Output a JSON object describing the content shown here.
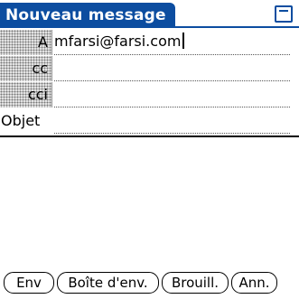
{
  "app": {
    "title": "Nouveau message"
  },
  "colors": {
    "accent": "#0c4da0",
    "background": "#ffffff",
    "text": "#000000"
  },
  "icons": {
    "menu": "menu-icon"
  },
  "fields": {
    "to": {
      "label": "A",
      "value": "mfarsi@farsi.com"
    },
    "cc": {
      "label": "cc",
      "value": ""
    },
    "bcc": {
      "label": "cci",
      "value": ""
    },
    "subject": {
      "label": "Objet",
      "value": ""
    }
  },
  "message_body": "",
  "buttons": {
    "send": "Env",
    "outbox": "Boîte d'env.",
    "drafts": "Brouill.",
    "cancel": "Ann."
  }
}
